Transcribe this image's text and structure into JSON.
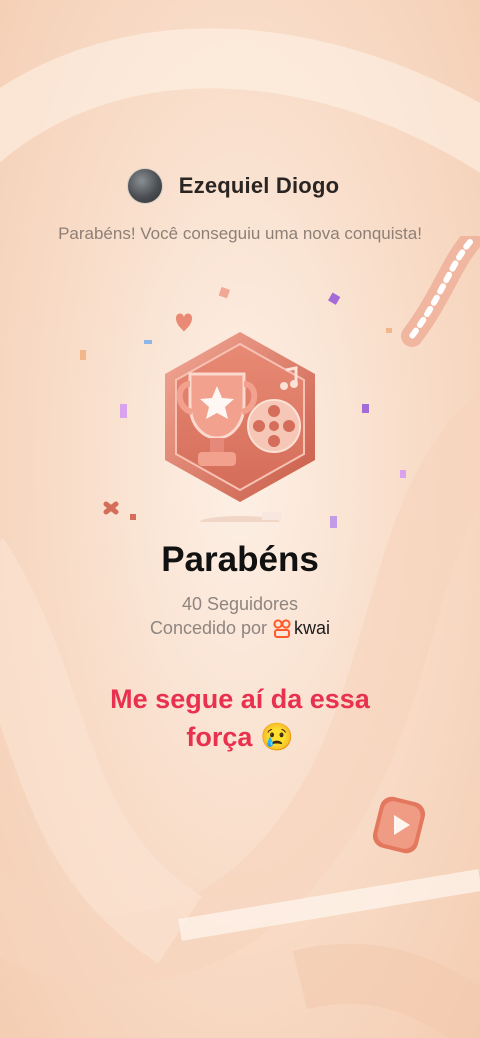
{
  "user": {
    "name": "Ezequiel Diogo"
  },
  "subtitle": "Parabéns! Você conseguiu uma nova conquista!",
  "achievement": {
    "title": "Parabéns",
    "followers": "40 Seguidores",
    "granted_by_label": "Concedido por",
    "brand": "kwai"
  },
  "message": {
    "line1": "Me segue aí da essa",
    "line2": "força",
    "emoji": "😢"
  },
  "colors": {
    "accent": "#e8304f",
    "badge": "#d9735f",
    "background": "#f9dfcc"
  },
  "icons": [
    "trophy-icon",
    "film-reel-icon",
    "kwai-logo-icon",
    "play-icon",
    "heart-icon",
    "music-note-icon"
  ]
}
